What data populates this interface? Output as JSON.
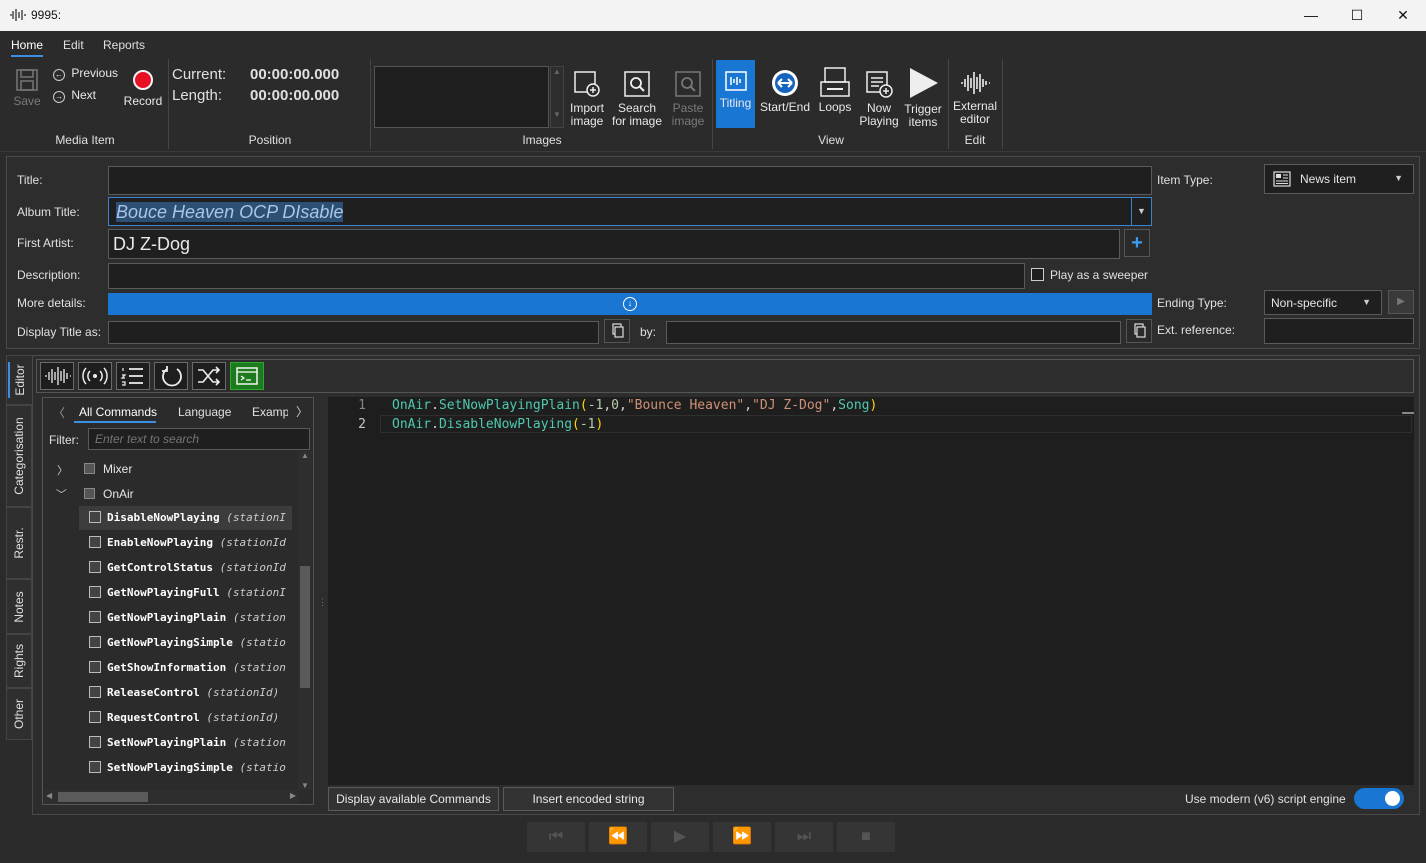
{
  "window": {
    "title": "9995:",
    "min": "—",
    "max": "☐",
    "close": "✕"
  },
  "ribbon": {
    "tabs": [
      "Home",
      "Edit",
      "Reports"
    ],
    "media_item": {
      "save": "Save",
      "previous": "Previous",
      "next": "Next",
      "record": "Record",
      "group": "Media Item"
    },
    "position": {
      "current_label": "Current:",
      "current_value": "00:00:00.000",
      "length_label": "Length:",
      "length_value": "00:00:00.000",
      "group": "Position"
    },
    "images": {
      "import": "Import image",
      "search": "Search for image",
      "paste": "Paste image",
      "group": "Images"
    },
    "view": {
      "titling": "Titling",
      "start_end": "Start/End",
      "loops": "Loops",
      "now_playing": "Now Playing",
      "trigger": "Trigger items",
      "group": "View"
    },
    "edit": {
      "external": "External editor",
      "group": "Edit"
    }
  },
  "form": {
    "title_label": "Title:",
    "title_value": "",
    "album_label": "Album Title:",
    "album_value": "Bouce Heaven OCP DIsable",
    "artist_label": "First Artist:",
    "artist_value": "DJ Z-Dog",
    "description_label": "Description:",
    "description_value": "",
    "sweeper_label": "Play as a sweeper",
    "more_details_label": "More details:",
    "display_title_label": "Display Title as:",
    "display_title_value": "",
    "by_label": "by:",
    "by_value": "",
    "item_type_label": "Item Type:",
    "item_type_value": "News item",
    "ending_type_label": "Ending Type:",
    "ending_type_value": "Non-specific",
    "ext_ref_label": "Ext. reference:",
    "ext_ref_value": ""
  },
  "side_tabs": [
    "Editor",
    "Categorisation",
    "Restr.",
    "Notes",
    "Rights",
    "Other"
  ],
  "commands": {
    "tabs": [
      "All Commands",
      "Language",
      "Examp"
    ],
    "filter_label": "Filter:",
    "filter_placeholder": "Enter text to search",
    "groups": [
      "Mixer",
      "OnAir"
    ],
    "items": [
      {
        "name": "DisableNowPlaying",
        "args": "(stationI"
      },
      {
        "name": "EnableNowPlaying",
        "args": "(stationId"
      },
      {
        "name": "GetControlStatus",
        "args": "(stationId"
      },
      {
        "name": "GetNowPlayingFull",
        "args": "(stationI"
      },
      {
        "name": "GetNowPlayingPlain",
        "args": "(station"
      },
      {
        "name": "GetNowPlayingSimple",
        "args": "(statio"
      },
      {
        "name": "GetShowInformation",
        "args": "(station"
      },
      {
        "name": "ReleaseControl",
        "args": "(stationId)"
      },
      {
        "name": "RequestControl",
        "args": "(stationId)"
      },
      {
        "name": "SetNowPlayingPlain",
        "args": "(station"
      },
      {
        "name": "SetNowPlayingSimple",
        "args": "(statio"
      }
    ]
  },
  "code": {
    "lines": [
      {
        "num": "1",
        "obj": "OnAir",
        "fn": "SetNowPlayingPlain",
        "args": [
          "-1",
          "0",
          "\"Bounce Heaven\"",
          "\"DJ Z-Dog\"",
          "Song"
        ]
      },
      {
        "num": "2",
        "obj": "OnAir",
        "fn": "DisableNowPlaying",
        "args": [
          "-1"
        ]
      }
    ]
  },
  "bottom": {
    "display_cmds": "Display available Commands",
    "insert_encoded": "Insert encoded string",
    "engine_label": "Use modern (v6) script engine",
    "engine_on": true
  },
  "colors": {
    "accent": "#1976d2",
    "record": "#e81123"
  }
}
